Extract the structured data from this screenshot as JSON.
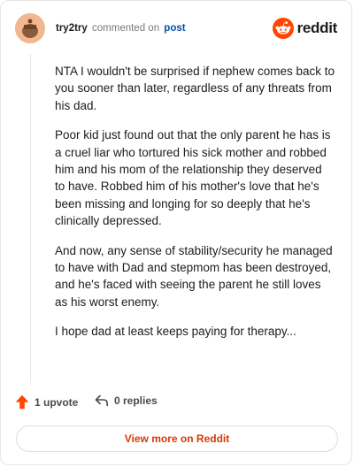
{
  "header": {
    "username": "try2try",
    "action_text": "commented on",
    "post_link": "post",
    "logo_text": "reddit",
    "avatar_icon": "avatar-icon",
    "brand_color": "#ff4500"
  },
  "comment": {
    "paragraphs": [
      "NTA I wouldn't be surprised if nephew comes back to you sooner than later, regardless of any threats from his dad.",
      "Poor kid just found out that the only parent he has is a cruel liar who tortured his sick mother and robbed him and his mom of the relationship they deserved to have. Robbed him of his mother's love that he's been missing and longing for so deeply that he's clinically depressed.",
      "And now, any sense of stability/security he managed to have with Dad and stepmom has been destroyed, and he's faced with seeing the parent he still loves as his worst enemy.",
      "I hope dad at least keeps paying for therapy..."
    ]
  },
  "footer": {
    "upvote_label": "1 upvote",
    "replies_label": "0 replies",
    "upvote_icon": "upvote-arrow-icon",
    "reply_icon": "reply-arrow-icon",
    "upvote_color": "#ff4500"
  },
  "view_more": {
    "label": "View more on Reddit",
    "color": "#d93900"
  }
}
